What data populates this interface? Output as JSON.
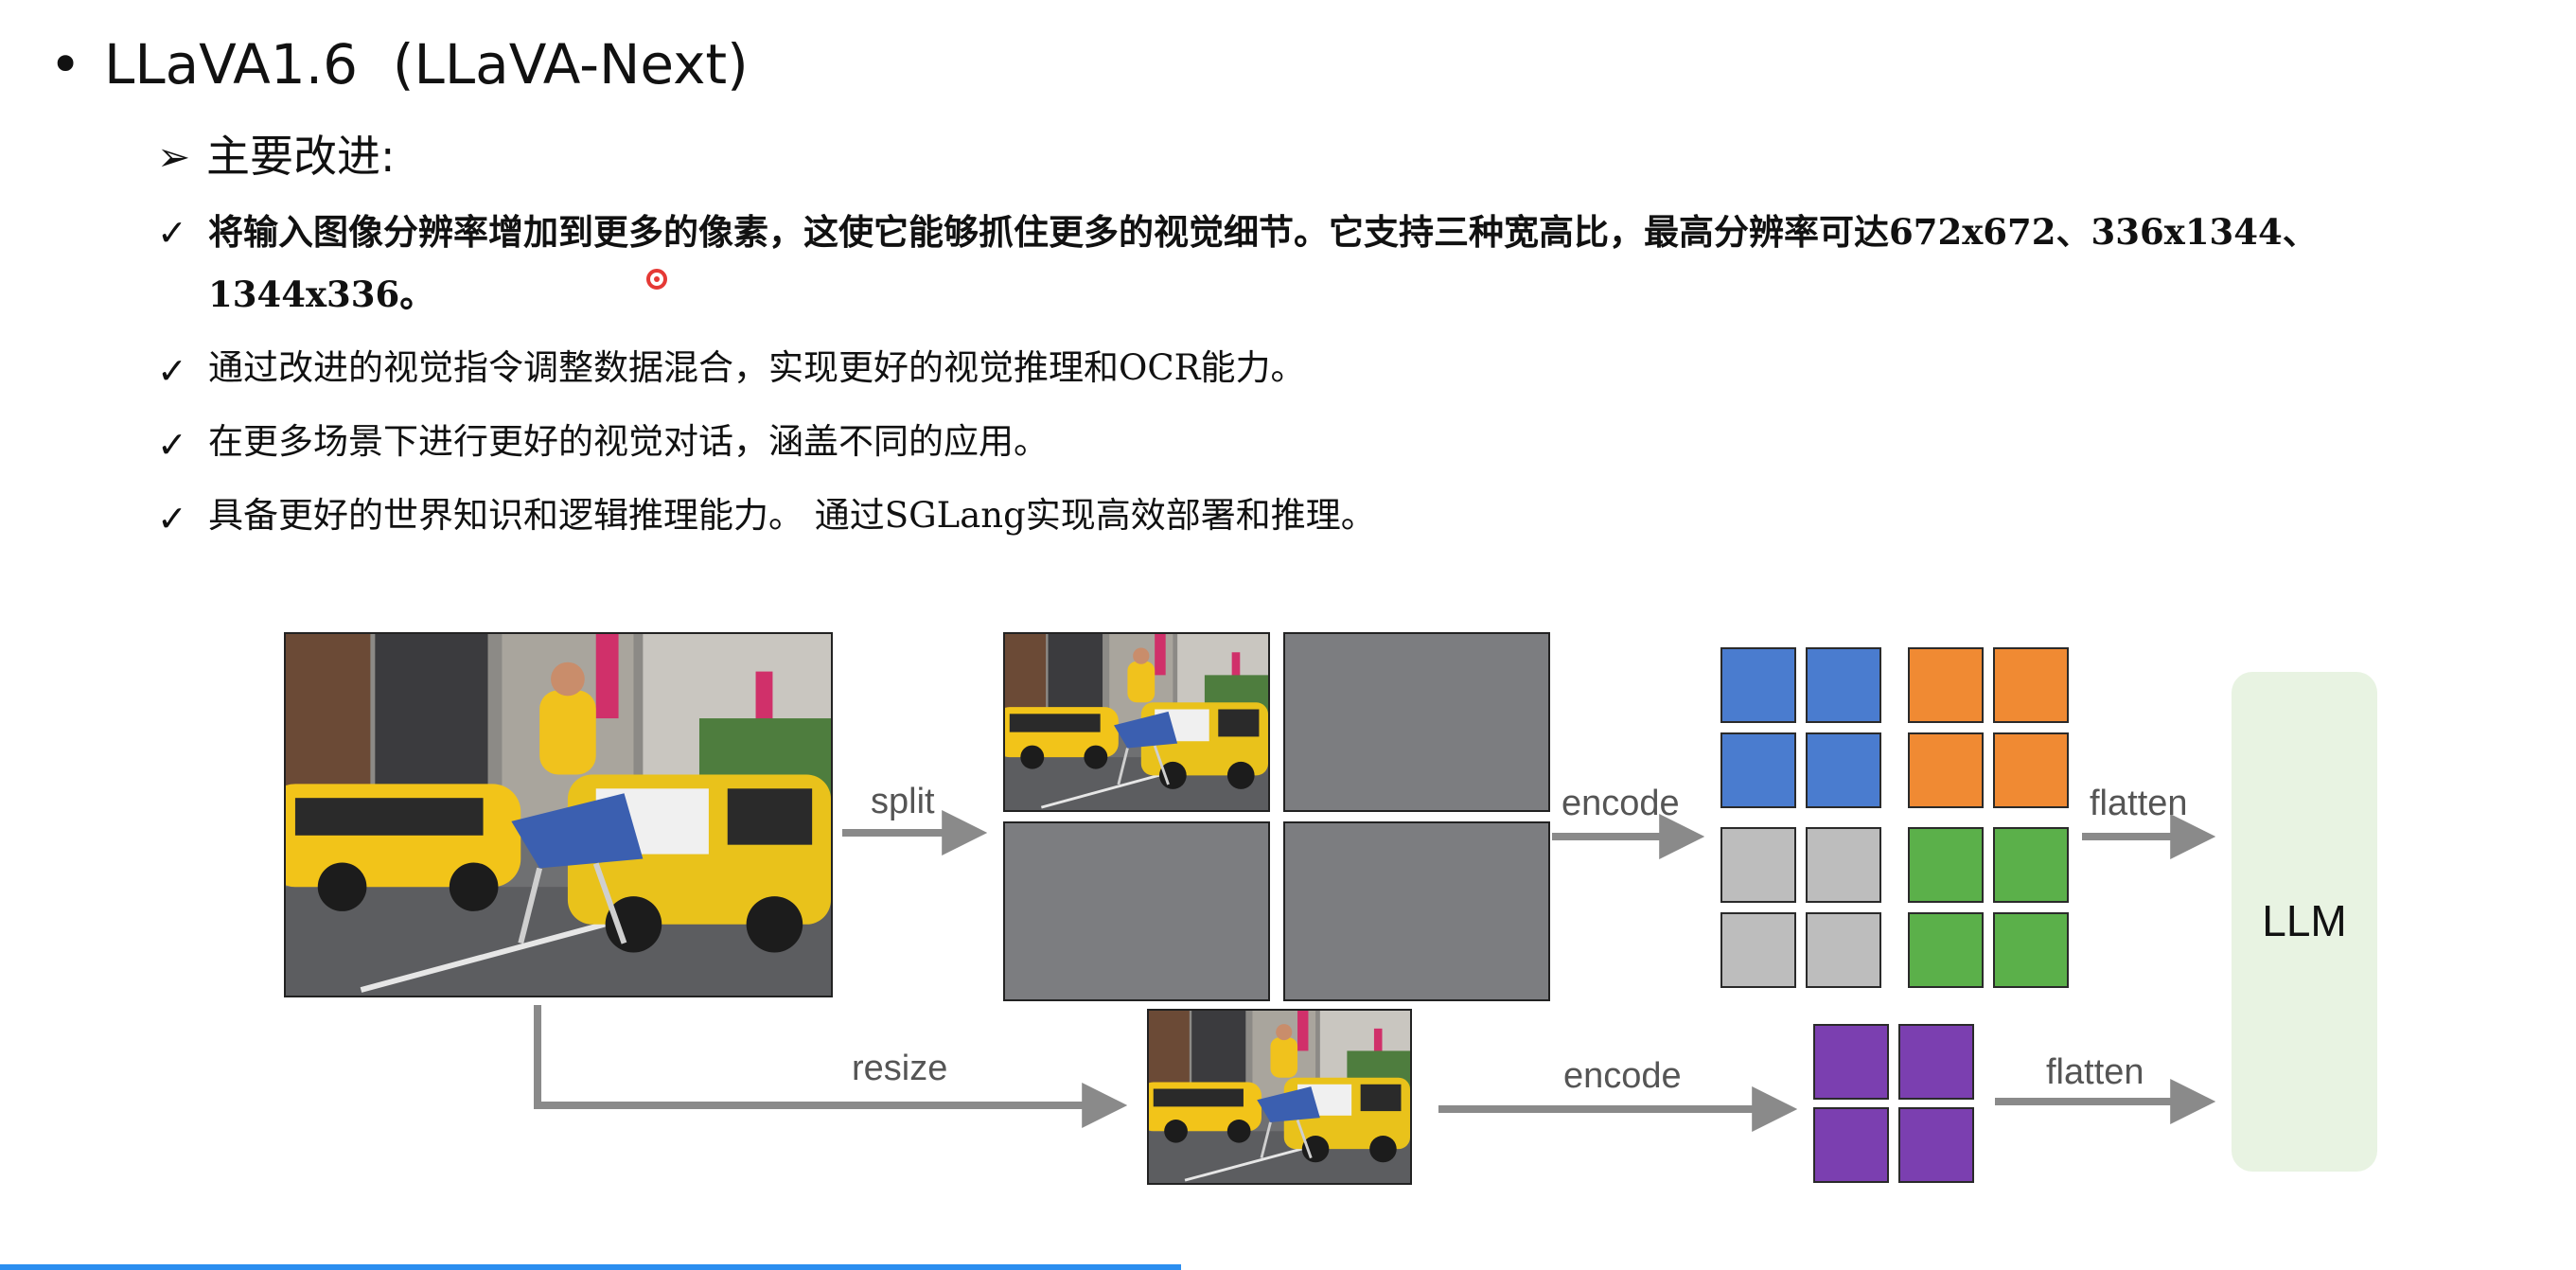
{
  "slide": {
    "bullet": "•",
    "title": "LLaVA1.6  (LLaVA-Next)",
    "subhead_marker": "➢",
    "subhead": "主要改进:",
    "check": "✓",
    "points": [
      {
        "line1": "将输入图像分辨率增加到更多的像素，这使它能够抓住更多的视觉细节。它支持三种宽高比，最高分辨率可达672x672、336x1344、",
        "line2": "1344x336。"
      },
      {
        "text": " 通过改进的视觉指令调整数据混合，实现更好的视觉推理和OCR能力。"
      },
      {
        "text": "在更多场景下进行更好的视觉对话，涵盖不同的应用。"
      },
      {
        "text": "具备更好的世界知识和逻辑推理能力。  通过SGLang实现高效部署和推理。"
      }
    ]
  },
  "diagram": {
    "labels": {
      "split": "split",
      "encode_top": "encode",
      "flatten_top": "flatten",
      "resize": "resize",
      "encode_bottom": "encode",
      "flatten_bottom": "flatten",
      "llm": "LLM"
    },
    "colors": {
      "blue": "#4a7ccf",
      "orange": "#f08a33",
      "gray": "#bdbdbd",
      "green": "#5bb04a",
      "purple": "#7b3fb0",
      "llm_box": "#e8f3e2",
      "arrow": "#8a8a8a"
    }
  },
  "ui": {
    "progress_color": "#2b8ef0"
  }
}
